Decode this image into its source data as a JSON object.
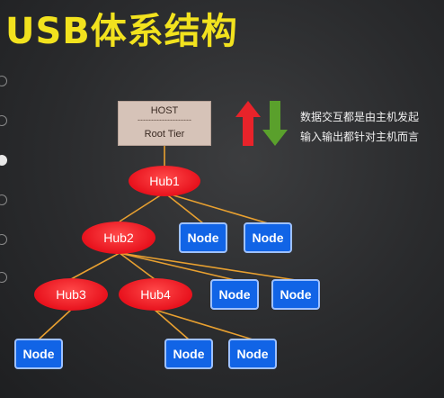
{
  "title": "USB体系结构",
  "host": {
    "line1": "HOST",
    "separator": "--------------------",
    "line2": "Root Tier"
  },
  "hubs": {
    "hub1": "Hub1",
    "hub2": "Hub2",
    "hub3": "Hub3",
    "hub4": "Hub4"
  },
  "nodes": {
    "label": "Node"
  },
  "notes": {
    "line1": "数据交互都是由主机发起",
    "line2": "输入输出都针对主机而言"
  },
  "colors": {
    "title": "#f2e21e",
    "hub": "#e8121d",
    "node": "#1164e6",
    "up_arrow": "#e8232a",
    "down_arrow": "#5aa02c",
    "edge": "#e8a030"
  }
}
